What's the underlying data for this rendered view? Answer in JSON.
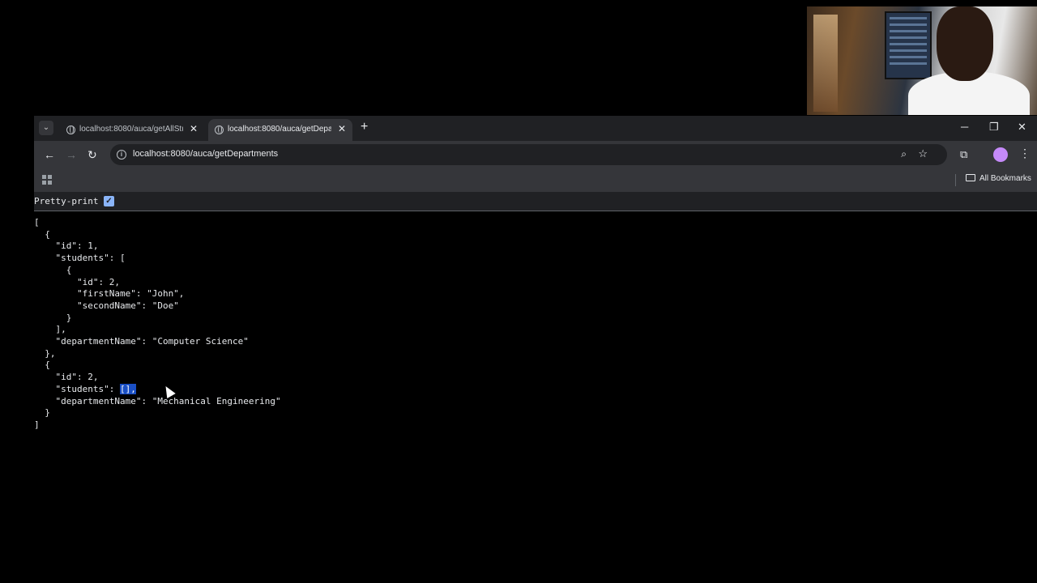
{
  "browser": {
    "tabs": [
      {
        "title": "localhost:8080/auca/getAllStud",
        "active": false
      },
      {
        "title": "localhost:8080/auca/getDeparts",
        "active": true
      }
    ],
    "new_tab_label": "+",
    "window_controls": {
      "minimize": "─",
      "restore": "❐",
      "close": "✕"
    },
    "nav": {
      "back": "←",
      "forward": "→",
      "reload": "↻"
    },
    "url": "localhost:8080/auca/getDepartments",
    "bookmarks": {
      "all_bookmarks_label": "All Bookmarks"
    },
    "menu_icon": "⋮"
  },
  "pretty_print": {
    "label": "Pretty-print",
    "checked": true
  },
  "json": {
    "lines_before_selection": "[\n  {\n    \"id\": 1,\n    \"students\": [\n      {\n        \"id\": 2,\n        \"firstName\": \"John\",\n        \"secondName\": \"Doe\"\n      }\n    ],\n    \"departmentName\": \"Computer Science\"\n  },\n  {\n    \"id\": 2,\n    \"students\": ",
    "selected_text": "[],",
    "lines_after_selection": "\n    \"departmentName\": \"Mechanical Engineering\"\n  }\n]"
  },
  "icons": {
    "tab_menu": "chevron-down-icon",
    "tab_favicon": "globe-icon",
    "tab_close": "close-icon",
    "site_info": "info-icon",
    "zoom": "zoom-icon",
    "bookmark_star": "star-icon",
    "extensions": "puzzle-icon",
    "apps": "apps-grid-icon",
    "bookmark_folder": "folder-icon"
  },
  "colors": {
    "tab_strip": "#202124",
    "toolbar": "#35363a",
    "selection": "#1a4fc4",
    "checkbox": "#8ab4f8"
  }
}
